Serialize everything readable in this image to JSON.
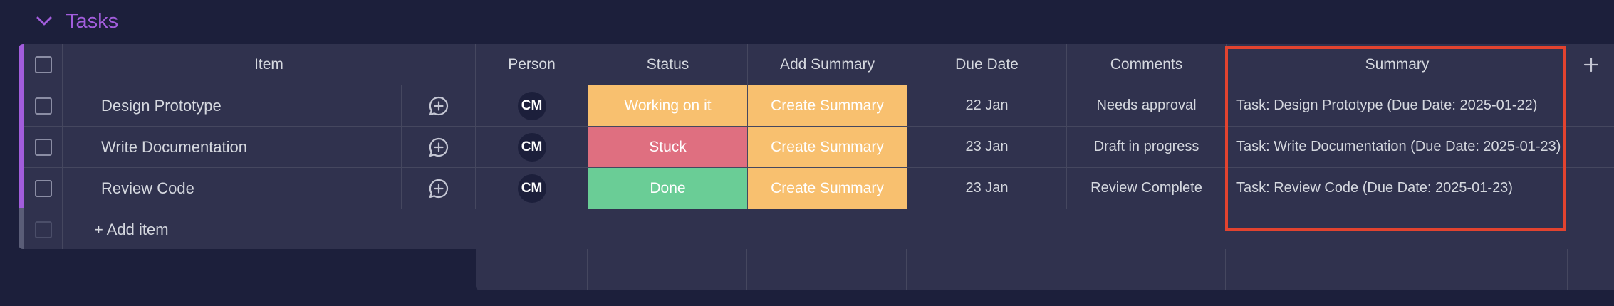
{
  "group": {
    "title": "Tasks",
    "color": "#a25ddc"
  },
  "columns": {
    "item": "Item",
    "person": "Person",
    "status": "Status",
    "add_summary": "Add Summary",
    "due_date": "Due Date",
    "comments": "Comments",
    "summary": "Summary"
  },
  "rows": [
    {
      "item": "Design Prototype",
      "person": "CM",
      "status": "Working on it",
      "status_color": "#fdbc64",
      "add_summary": "Create Summary",
      "due_date": "22 Jan",
      "comments": "Needs approval",
      "summary": "Task: Design Prototype (Due Date: 2025-01-22)"
    },
    {
      "item": "Write Documentation",
      "person": "CM",
      "status": "Stuck",
      "status_color": "#df6f80",
      "add_summary": "Create Summary",
      "due_date": "23 Jan",
      "comments": "Draft in progress",
      "summary": "Task: Write Documentation (Due Date: 2025-01-23)"
    },
    {
      "item": "Review Code",
      "person": "CM",
      "status": "Done",
      "status_color": "#6acd96",
      "add_summary": "Create Summary",
      "due_date": "23 Jan",
      "comments": "Review Complete",
      "summary": "Task: Review Code (Due Date: 2025-01-23)"
    }
  ],
  "add_item": {
    "label": "+ Add item"
  },
  "colors": {
    "create_summary": "#f8c06f",
    "highlight": "#e2432f"
  }
}
